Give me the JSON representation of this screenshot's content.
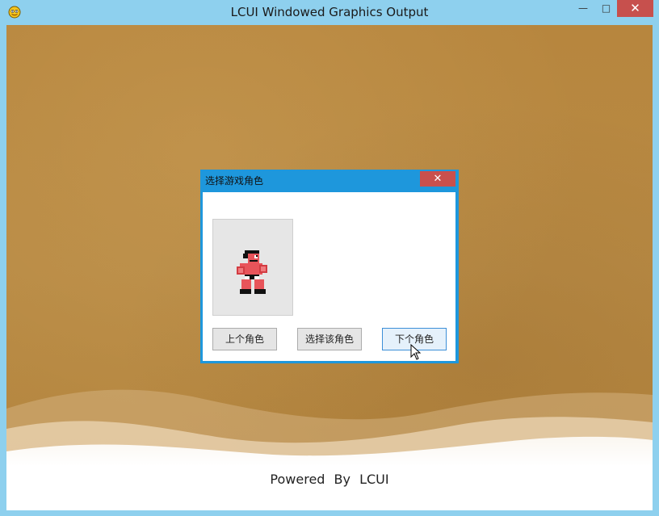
{
  "window": {
    "title": "LCUI Windowed Graphics Output",
    "icons": {
      "app": "smiley-app-icon",
      "minimize": "minimize-icon",
      "maximize": "maximize-icon",
      "close": "close-icon"
    },
    "controls": {
      "minimize": "—",
      "maximize": "□",
      "close": "✕"
    }
  },
  "dialog": {
    "title": "选择游戏角色",
    "close": "✕",
    "character_icon": "boxer-sprite-icon",
    "buttons": {
      "prev": "上个角色",
      "select": "选择该角色",
      "next": "下个角色"
    }
  },
  "footer": {
    "text": "Powered  By  LCUI"
  },
  "colors": {
    "titlebar": "#8ed0ee",
    "background": "#b6853d",
    "dialog_frame": "#1e97dc",
    "close_red": "#c7504d"
  }
}
